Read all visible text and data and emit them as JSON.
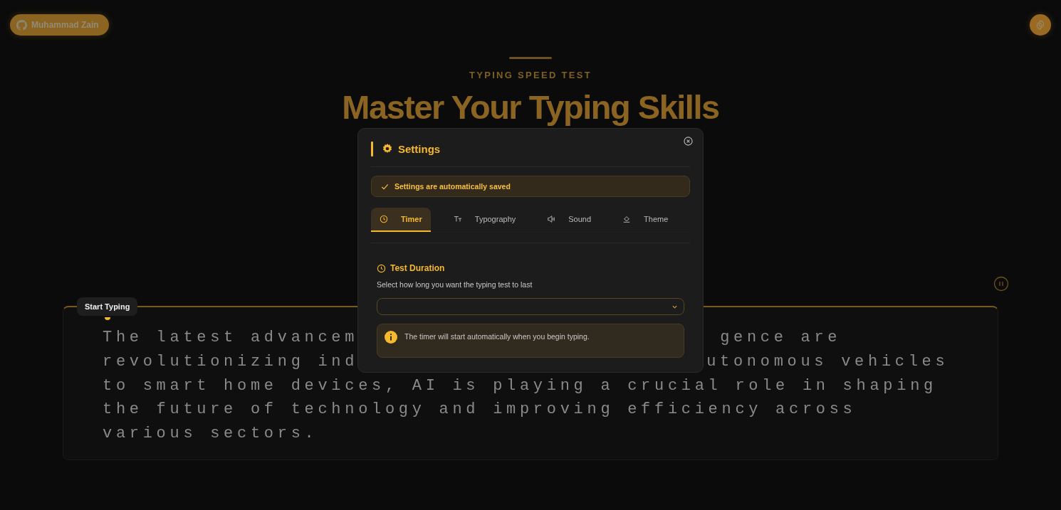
{
  "profile_button": {
    "label": "Muhammad Zain"
  },
  "header": {
    "eyebrow": "TYPING SPEED TEST",
    "title": "Master Your Typing Skills"
  },
  "typing_area": {
    "tooltip": "Start Typing",
    "lines": [
      {
        "left": "The latest advancem",
        "right": "gence are"
      },
      {
        "left": "revolutionizing ind",
        "right": "utonomous vehicles"
      },
      {
        "left": "to smart home devices, AI is playing a crucial role in shaping"
      },
      {
        "left": "the future of technology and improving efficiency across"
      },
      {
        "left": "various sectors."
      }
    ]
  },
  "settings_dialog": {
    "title": "Settings",
    "notice": "Settings are automatically saved",
    "tabs": [
      {
        "label": "Timer",
        "selected": true
      },
      {
        "label": "Typography",
        "selected": false
      },
      {
        "label": "Sound",
        "selected": false
      },
      {
        "label": "Theme",
        "selected": false
      }
    ],
    "section": {
      "title": "Test Duration",
      "description": "Select how long you want the typing test to last",
      "info": "The timer will start automatically when you begin typing."
    }
  }
}
